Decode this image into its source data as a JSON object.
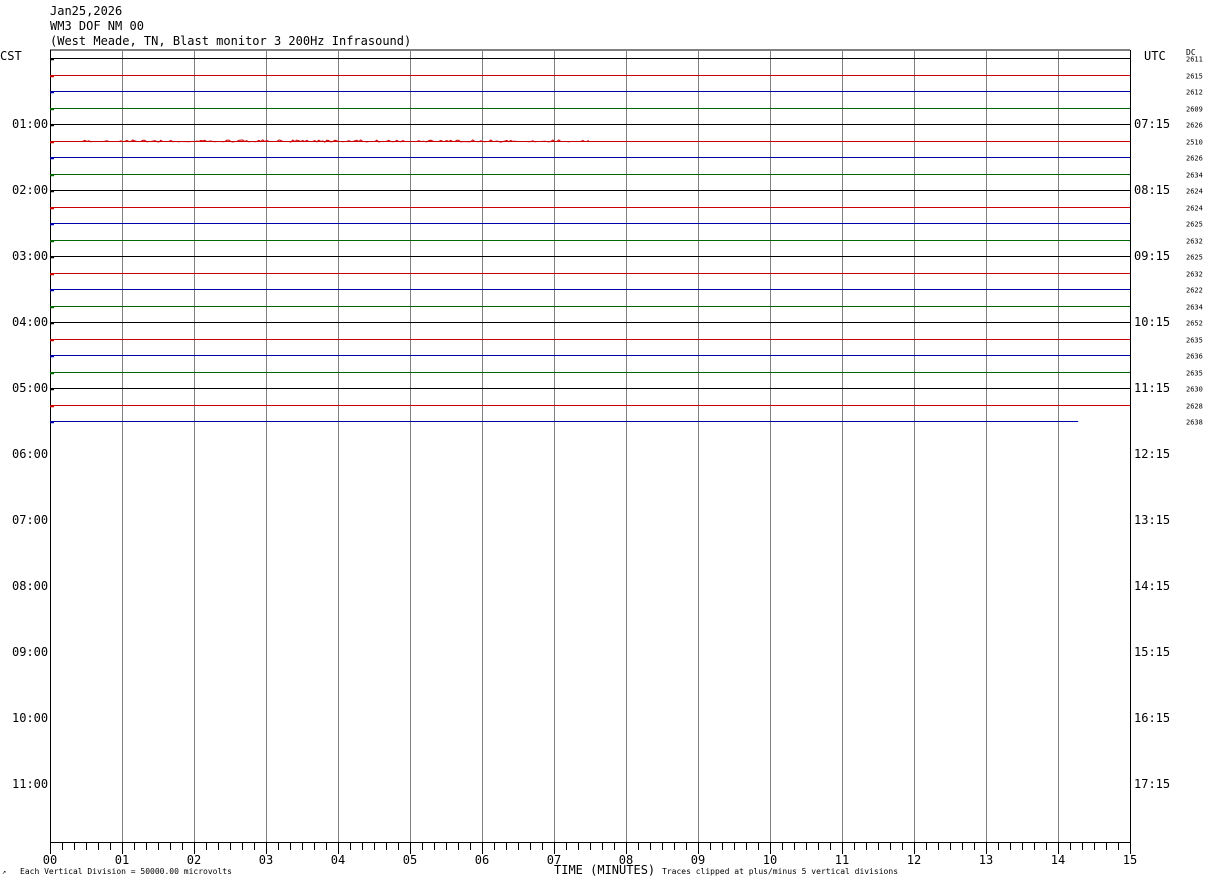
{
  "header": {
    "date": "Jan25,2026",
    "station": "WM3 DOF NM 00",
    "description": "(West Meade, TN, Blast monitor 3 200Hz Infrasound)"
  },
  "left_tz": "CST",
  "right_tz": "UTC",
  "dc_label": "DC",
  "footer": {
    "left_note": "Each Vertical Division = 50000.00 microvolts",
    "x_label": "TIME (MINUTES)",
    "right_note": "Traces clipped at plus/minus 5 vertical divisions"
  },
  "colors": {
    "trace_cycle": [
      "#000000",
      "#cc0000",
      "#0000aa",
      "#006600"
    ],
    "grid": "#808080"
  },
  "chart_data": {
    "type": "line",
    "title": "",
    "xlabel": "TIME (MINUTES)",
    "xlim": [
      0,
      15
    ],
    "x_ticks": [
      "00",
      "01",
      "02",
      "03",
      "04",
      "05",
      "06",
      "07",
      "08",
      "09",
      "10",
      "11",
      "12",
      "13",
      "14",
      "15"
    ],
    "row_minutes": 15,
    "total_rows": 48,
    "left_hour_labels": [
      "01:00",
      "02:00",
      "03:00",
      "04:00",
      "05:00",
      "06:00",
      "07:00",
      "08:00",
      "09:00",
      "10:00",
      "11:00"
    ],
    "right_hour_labels": [
      "07:15",
      "08:15",
      "09:15",
      "10:15",
      "11:15",
      "12:15",
      "13:15",
      "14:15",
      "15:15",
      "16:15",
      "17:15"
    ],
    "hour_label_start_row": 4,
    "traces": [
      {
        "row": 0,
        "end_minute": 15,
        "dc": "2611"
      },
      {
        "row": 1,
        "end_minute": 15,
        "dc": "2615"
      },
      {
        "row": 2,
        "end_minute": 15,
        "dc": "2612"
      },
      {
        "row": 3,
        "end_minute": 15,
        "dc": "2609"
      },
      {
        "row": 4,
        "end_minute": 15,
        "dc": "2626"
      },
      {
        "row": 5,
        "end_minute": 15,
        "dc": "2510",
        "activity": [
          0.4,
          7.5
        ]
      },
      {
        "row": 6,
        "end_minute": 15,
        "dc": "2626"
      },
      {
        "row": 7,
        "end_minute": 15,
        "dc": "2634"
      },
      {
        "row": 8,
        "end_minute": 15,
        "dc": "2624"
      },
      {
        "row": 9,
        "end_minute": 15,
        "dc": "2624"
      },
      {
        "row": 10,
        "end_minute": 15,
        "dc": "2625"
      },
      {
        "row": 11,
        "end_minute": 15,
        "dc": "2632"
      },
      {
        "row": 12,
        "end_minute": 15,
        "dc": "2625"
      },
      {
        "row": 13,
        "end_minute": 15,
        "dc": "2632"
      },
      {
        "row": 14,
        "end_minute": 15,
        "dc": "2622"
      },
      {
        "row": 15,
        "end_minute": 15,
        "dc": "2634"
      },
      {
        "row": 16,
        "end_minute": 15,
        "dc": "2652"
      },
      {
        "row": 17,
        "end_minute": 15,
        "dc": "2635"
      },
      {
        "row": 18,
        "end_minute": 15,
        "dc": "2636"
      },
      {
        "row": 19,
        "end_minute": 15,
        "dc": "2635"
      },
      {
        "row": 20,
        "end_minute": 15,
        "dc": "2630"
      },
      {
        "row": 21,
        "end_minute": 15,
        "dc": "2628"
      },
      {
        "row": 22,
        "end_minute": 14.28,
        "dc": "2638"
      }
    ]
  }
}
